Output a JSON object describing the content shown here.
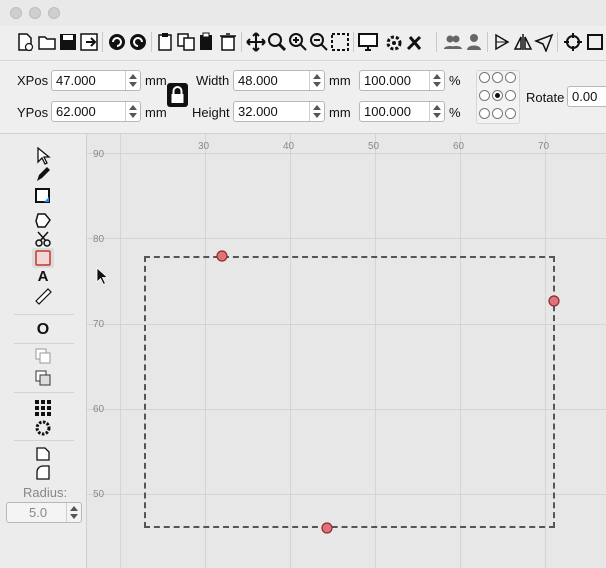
{
  "colors": {
    "accent": "#e0737a",
    "selection": "#555555",
    "brand_bar": "#9b1b2a"
  },
  "toolbar": {
    "icons": [
      "new-file-icon",
      "open-folder-icon",
      "save-icon",
      "save-as-icon",
      "undo-icon",
      "redo-icon",
      "cut-icon",
      "copy-icon",
      "paste-icon",
      "delete-icon",
      "move-icon",
      "zoom-fit-icon",
      "zoom-in-icon",
      "zoom-out-icon",
      "select-frame-icon",
      "monitor-icon",
      "settings-icon",
      "tools-icon",
      "group-icon",
      "user-icon",
      "align-icon",
      "mirror-icon",
      "send-icon",
      "target-icon",
      "frame-icon"
    ]
  },
  "props": {
    "xpos_label": "XPos",
    "xpos_value": "47.000",
    "xpos_unit": "mm",
    "ypos_label": "YPos",
    "ypos_value": "62.000",
    "ypos_unit": "mm",
    "width_label": "Width",
    "width_value": "48.000",
    "width_unit": "mm",
    "height_label": "Height",
    "height_value": "32.000",
    "height_unit": "mm",
    "scale_x_value": "100.000",
    "scale_x_unit": "%",
    "scale_y_value": "100.000",
    "scale_y_unit": "%",
    "rotate_label": "Rotate",
    "rotate_value": "0.00"
  },
  "tools": {
    "icons": [
      "select-arrow-icon",
      "draw-pencil-icon",
      "edit-nodes-icon",
      "polygon-icon",
      "scissors-icon",
      "rectangle-icon",
      "text-icon",
      "measure-icon",
      "offset-icon",
      "weld-icon",
      "boolean-icon",
      "array-grid-icon",
      "circular-array-icon",
      "corner-chamfer-icon",
      "corner-round-icon"
    ],
    "text_tool": "A",
    "offset_tool": "O",
    "radius_label": "Radius:",
    "radius_value": "5.0"
  },
  "canvas": {
    "x_ticks": [
      "30",
      "40",
      "50",
      "60",
      "70"
    ],
    "y_ticks": [
      "90",
      "80",
      "70",
      "60",
      "50"
    ]
  }
}
